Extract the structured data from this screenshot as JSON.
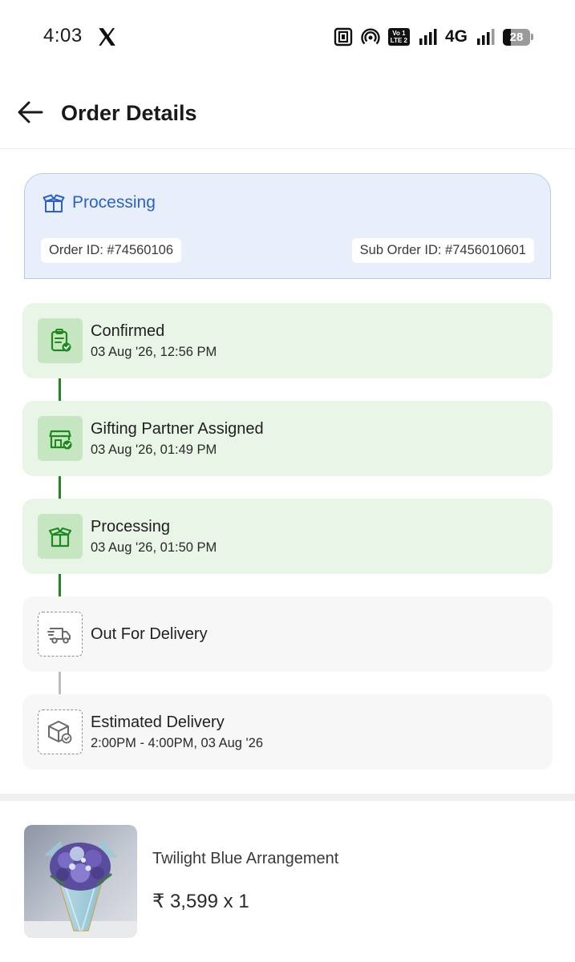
{
  "status_bar": {
    "time": "4:03",
    "network": "4G",
    "volte_line1": "Vo 1",
    "volte_line2": "LTE 2",
    "battery_level": "28"
  },
  "header": {
    "title": "Order Details",
    "back_icon": "arrow-left-icon"
  },
  "order_status": {
    "label": "Processing",
    "icon": "package-open-icon",
    "order_id": "Order ID: #74560106",
    "sub_order_id": "Sub Order ID: #7456010601",
    "accent_color": "#2a62c9"
  },
  "timeline": {
    "done_color": "#1e8a1e",
    "pending_color": "#bdbdbd",
    "steps": [
      {
        "title": "Confirmed",
        "date": "03 Aug '26, 12:56 PM",
        "icon": "clipboard-check-icon",
        "state": "done"
      },
      {
        "title": "Gifting Partner Assigned",
        "date": "03 Aug '26, 01:49 PM",
        "icon": "store-check-icon",
        "state": "done"
      },
      {
        "title": "Processing",
        "date": "03 Aug '26, 01:50 PM",
        "icon": "package-open-icon",
        "state": "done"
      },
      {
        "title": "Out For Delivery",
        "date": "",
        "icon": "delivery-truck-icon",
        "state": "pending"
      },
      {
        "title": "Estimated Delivery",
        "date": "2:00PM - 4:00PM, 03 Aug '26",
        "icon": "box-check-icon",
        "state": "pending"
      }
    ]
  },
  "product": {
    "name": "Twilight Blue Arrangement",
    "price": "₹ 3,599 x 1",
    "image_icon": "flower-bouquet-image"
  }
}
